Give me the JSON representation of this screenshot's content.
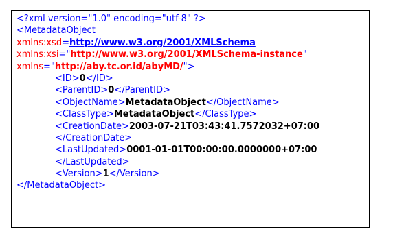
{
  "declaration": "<?xml version=\"1.0\" encoding=\"utf-8\" ?>",
  "root": {
    "open": "<MetadataObject",
    "close": "</MetadataObject>"
  },
  "namespaces": [
    {
      "attr": "xmlns:xsd",
      "eq": "=",
      "value": "http://www.w3.org/2001/XMLSchema"
    },
    {
      "attr": "xmlns:xsi",
      "eq": "=\"",
      "value": "http://www.w3.org/2001/XMLSchema-instance",
      "end": "\""
    },
    {
      "attr": "xmlns",
      "eq": "=\"",
      "value": "http://aby.tc.or.id/abyMD/",
      "end": "\">"
    }
  ],
  "elements": {
    "id": {
      "open": "<ID>",
      "value": "0",
      "close": "</ID>"
    },
    "parent_id": {
      "open": "<ParentID>",
      "value": "0",
      "close": "</ParentID>"
    },
    "object_name": {
      "open": "<ObjectName>",
      "value": "MetadataObject",
      "close": "</ObjectName>"
    },
    "class_type": {
      "open": "<ClassType>",
      "value": "MetadataObject",
      "close": "</ClassType>"
    },
    "creation_date": {
      "open": "<CreationDate>",
      "value": "2003-07-21T03:43:41.7572032+07:00",
      "close": "</CreationDate>"
    },
    "last_updated": {
      "open": "<LastUpdated>",
      "value": "0001-01-01T00:00:00.0000000+07:00",
      "close": "</LastUpdated>"
    },
    "version": {
      "open": "<Version>",
      "value": "1",
      "close": "</Version>"
    }
  }
}
